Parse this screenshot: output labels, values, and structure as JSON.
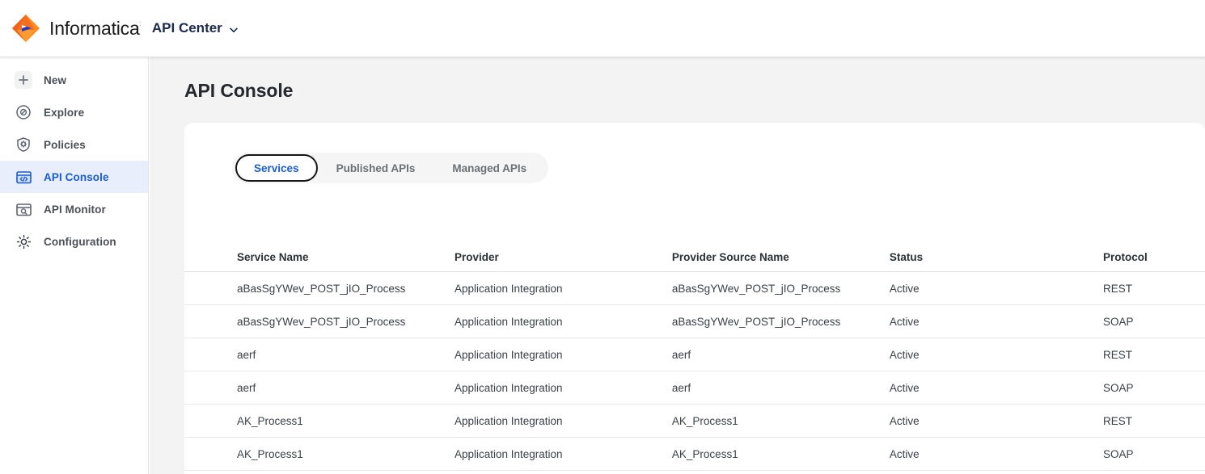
{
  "header": {
    "brand": "Informatica",
    "brand_trademark": "ː",
    "app_name": "API Center",
    "chevron_icon": "chevron-down-icon",
    "logo_icon": "informatica-logo-icon",
    "logo_colors": {
      "orange_dark": "#f06a1e",
      "orange_light": "#ff9a2e",
      "blue": "#1f35cc"
    }
  },
  "sidebar": {
    "items": [
      {
        "label": "New",
        "icon": "plus-icon",
        "active": false
      },
      {
        "label": "Explore",
        "icon": "compass-icon",
        "active": false
      },
      {
        "label": "Policies",
        "icon": "shield-gear-icon",
        "active": false
      },
      {
        "label": "API Console",
        "icon": "code-window-icon",
        "active": true
      },
      {
        "label": "API Monitor",
        "icon": "window-search-icon",
        "active": false
      },
      {
        "label": "Configuration",
        "icon": "gear-icon",
        "active": false
      }
    ],
    "active_bg": "#e8eefc",
    "active_fg": "#1a5ccc"
  },
  "main": {
    "page_title": "API Console",
    "tabs": [
      {
        "label": "Services",
        "active": true
      },
      {
        "label": "Published APIs",
        "active": false
      },
      {
        "label": "Managed APIs",
        "active": false
      }
    ],
    "table": {
      "columns": [
        "Service Name",
        "Provider",
        "Provider Source Name",
        "Status",
        "Protocol"
      ],
      "rows": [
        {
          "service_name": "aBasSgYWev_POST_jIO_Process",
          "provider": "Application Integration",
          "provider_source_name": "aBasSgYWev_POST_jIO_Process",
          "status": "Active",
          "protocol": "REST"
        },
        {
          "service_name": "aBasSgYWev_POST_jIO_Process",
          "provider": "Application Integration",
          "provider_source_name": "aBasSgYWev_POST_jIO_Process",
          "status": "Active",
          "protocol": "SOAP"
        },
        {
          "service_name": "aerf",
          "provider": "Application Integration",
          "provider_source_name": "aerf",
          "status": "Active",
          "protocol": "REST"
        },
        {
          "service_name": "aerf",
          "provider": "Application Integration",
          "provider_source_name": "aerf",
          "status": "Active",
          "protocol": "SOAP"
        },
        {
          "service_name": "AK_Process1",
          "provider": "Application Integration",
          "provider_source_name": "AK_Process1",
          "status": "Active",
          "protocol": "REST"
        },
        {
          "service_name": "AK_Process1",
          "provider": "Application Integration",
          "provider_source_name": "AK_Process1",
          "status": "Active",
          "protocol": "SOAP"
        }
      ]
    }
  }
}
